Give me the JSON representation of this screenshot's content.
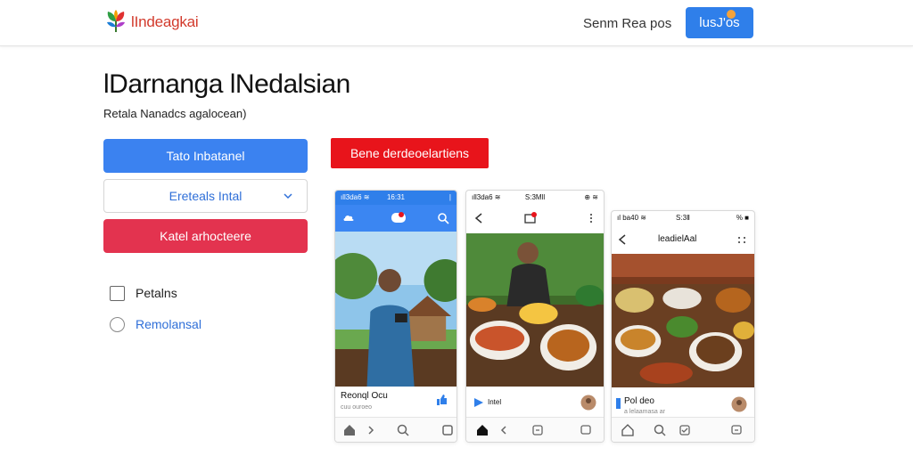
{
  "header": {
    "brand": "lIndeagkai",
    "nav_link": "Senm Rea pos",
    "cta_label": "lusJ'os"
  },
  "main": {
    "title": "lDarnanga lNedalsian",
    "subtitle": "Retala Nanadcs agalocean)"
  },
  "form": {
    "primary_button": "Tato Inbatanel",
    "select_value": "Ereteals Intal",
    "danger_button": "Katel arhocteere",
    "checkbox_label": "Petalns",
    "radio_label": "Remolansal"
  },
  "promo_button": "Bene derdeoelartiens",
  "phones": [
    {
      "status_left": "ıll3da6 ≋",
      "status_time": "16:31",
      "status_right": "|",
      "caption": "Reonql Ocu",
      "caption_sub": "cuu ouroeo"
    },
    {
      "status_left": "ıll3da6 ≋",
      "status_time": "S:3Mll",
      "status_right": "⊕ ≋",
      "caption": "Intel",
      "caption_sub": ""
    },
    {
      "status_left": "ıl ba40 ≋",
      "status_time": "S:3Ⅱ",
      "status_right": "% ■",
      "header_title": "leadielAal",
      "caption": "Pol deo",
      "caption_sub": "a lelaamasa ar"
    }
  ],
  "colors": {
    "accent_blue": "#3b82f0",
    "danger_pink": "#e3334f",
    "promo_red": "#e8141b",
    "brand_red": "#d23a2c"
  }
}
